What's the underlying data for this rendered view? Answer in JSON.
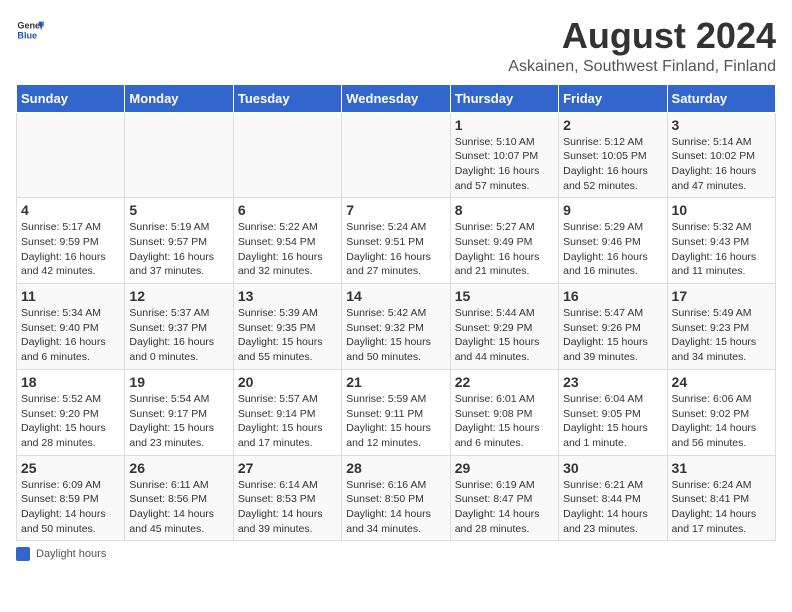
{
  "header": {
    "logo_general": "General",
    "logo_blue": "Blue",
    "title": "August 2024",
    "subtitle": "Askainen, Southwest Finland, Finland"
  },
  "columns": [
    "Sunday",
    "Monday",
    "Tuesday",
    "Wednesday",
    "Thursday",
    "Friday",
    "Saturday"
  ],
  "weeks": [
    [
      {
        "day": "",
        "info": ""
      },
      {
        "day": "",
        "info": ""
      },
      {
        "day": "",
        "info": ""
      },
      {
        "day": "",
        "info": ""
      },
      {
        "day": "1",
        "info": "Sunrise: 5:10 AM\nSunset: 10:07 PM\nDaylight: 16 hours and 57 minutes."
      },
      {
        "day": "2",
        "info": "Sunrise: 5:12 AM\nSunset: 10:05 PM\nDaylight: 16 hours and 52 minutes."
      },
      {
        "day": "3",
        "info": "Sunrise: 5:14 AM\nSunset: 10:02 PM\nDaylight: 16 hours and 47 minutes."
      }
    ],
    [
      {
        "day": "4",
        "info": "Sunrise: 5:17 AM\nSunset: 9:59 PM\nDaylight: 16 hours and 42 minutes."
      },
      {
        "day": "5",
        "info": "Sunrise: 5:19 AM\nSunset: 9:57 PM\nDaylight: 16 hours and 37 minutes."
      },
      {
        "day": "6",
        "info": "Sunrise: 5:22 AM\nSunset: 9:54 PM\nDaylight: 16 hours and 32 minutes."
      },
      {
        "day": "7",
        "info": "Sunrise: 5:24 AM\nSunset: 9:51 PM\nDaylight: 16 hours and 27 minutes."
      },
      {
        "day": "8",
        "info": "Sunrise: 5:27 AM\nSunset: 9:49 PM\nDaylight: 16 hours and 21 minutes."
      },
      {
        "day": "9",
        "info": "Sunrise: 5:29 AM\nSunset: 9:46 PM\nDaylight: 16 hours and 16 minutes."
      },
      {
        "day": "10",
        "info": "Sunrise: 5:32 AM\nSunset: 9:43 PM\nDaylight: 16 hours and 11 minutes."
      }
    ],
    [
      {
        "day": "11",
        "info": "Sunrise: 5:34 AM\nSunset: 9:40 PM\nDaylight: 16 hours and 6 minutes."
      },
      {
        "day": "12",
        "info": "Sunrise: 5:37 AM\nSunset: 9:37 PM\nDaylight: 16 hours and 0 minutes."
      },
      {
        "day": "13",
        "info": "Sunrise: 5:39 AM\nSunset: 9:35 PM\nDaylight: 15 hours and 55 minutes."
      },
      {
        "day": "14",
        "info": "Sunrise: 5:42 AM\nSunset: 9:32 PM\nDaylight: 15 hours and 50 minutes."
      },
      {
        "day": "15",
        "info": "Sunrise: 5:44 AM\nSunset: 9:29 PM\nDaylight: 15 hours and 44 minutes."
      },
      {
        "day": "16",
        "info": "Sunrise: 5:47 AM\nSunset: 9:26 PM\nDaylight: 15 hours and 39 minutes."
      },
      {
        "day": "17",
        "info": "Sunrise: 5:49 AM\nSunset: 9:23 PM\nDaylight: 15 hours and 34 minutes."
      }
    ],
    [
      {
        "day": "18",
        "info": "Sunrise: 5:52 AM\nSunset: 9:20 PM\nDaylight: 15 hours and 28 minutes."
      },
      {
        "day": "19",
        "info": "Sunrise: 5:54 AM\nSunset: 9:17 PM\nDaylight: 15 hours and 23 minutes."
      },
      {
        "day": "20",
        "info": "Sunrise: 5:57 AM\nSunset: 9:14 PM\nDaylight: 15 hours and 17 minutes."
      },
      {
        "day": "21",
        "info": "Sunrise: 5:59 AM\nSunset: 9:11 PM\nDaylight: 15 hours and 12 minutes."
      },
      {
        "day": "22",
        "info": "Sunrise: 6:01 AM\nSunset: 9:08 PM\nDaylight: 15 hours and 6 minutes."
      },
      {
        "day": "23",
        "info": "Sunrise: 6:04 AM\nSunset: 9:05 PM\nDaylight: 15 hours and 1 minute."
      },
      {
        "day": "24",
        "info": "Sunrise: 6:06 AM\nSunset: 9:02 PM\nDaylight: 14 hours and 56 minutes."
      }
    ],
    [
      {
        "day": "25",
        "info": "Sunrise: 6:09 AM\nSunset: 8:59 PM\nDaylight: 14 hours and 50 minutes."
      },
      {
        "day": "26",
        "info": "Sunrise: 6:11 AM\nSunset: 8:56 PM\nDaylight: 14 hours and 45 minutes."
      },
      {
        "day": "27",
        "info": "Sunrise: 6:14 AM\nSunset: 8:53 PM\nDaylight: 14 hours and 39 minutes."
      },
      {
        "day": "28",
        "info": "Sunrise: 6:16 AM\nSunset: 8:50 PM\nDaylight: 14 hours and 34 minutes."
      },
      {
        "day": "29",
        "info": "Sunrise: 6:19 AM\nSunset: 8:47 PM\nDaylight: 14 hours and 28 minutes."
      },
      {
        "day": "30",
        "info": "Sunrise: 6:21 AM\nSunset: 8:44 PM\nDaylight: 14 hours and 23 minutes."
      },
      {
        "day": "31",
        "info": "Sunrise: 6:24 AM\nSunset: 8:41 PM\nDaylight: 14 hours and 17 minutes."
      }
    ]
  ],
  "footer": {
    "label": "Daylight hours"
  }
}
